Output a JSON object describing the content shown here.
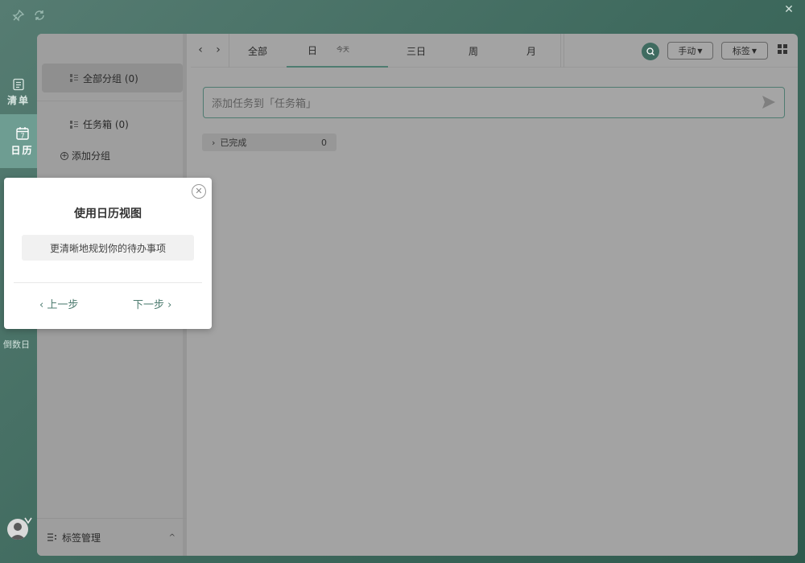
{
  "sidebar": {
    "items": [
      {
        "label": "清单"
      },
      {
        "label": "日历",
        "icon_digit": "7"
      },
      {
        "label": "倒数日"
      }
    ]
  },
  "groups": {
    "all_label": "全部分组 (0)",
    "inbox_label": "任务箱 (0)",
    "add_label": "添加分组",
    "tag_manage_label": "标签管理"
  },
  "toolbar": {
    "tabs": [
      {
        "label": "全部"
      },
      {
        "label": "日",
        "badge": "今天"
      },
      {
        "label": "三日"
      },
      {
        "label": "周"
      },
      {
        "label": "月"
      }
    ],
    "sort_label": "手动",
    "tag_label": "标签"
  },
  "main": {
    "input_placeholder": "添加任务到「任务箱」",
    "completed_label": "已完成",
    "completed_count": "0"
  },
  "tour": {
    "title": "使用日历视图",
    "description": "更清晰地规划你的待办事项",
    "prev_label": "上一步",
    "next_label": "下一步"
  },
  "colors": {
    "accent": "#4e7c70",
    "active_sidebar": "#6e9d92"
  }
}
